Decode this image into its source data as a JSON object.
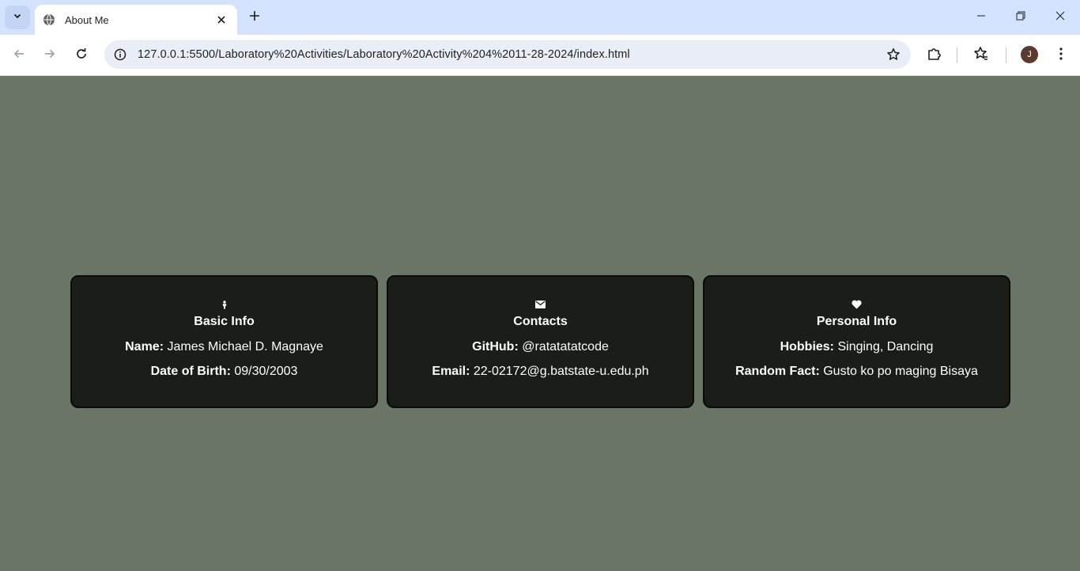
{
  "browser": {
    "tab_title": "About Me",
    "url": "127.0.0.1:5500/Laboratory%20Activities/Laboratory%20Activity%204%2011-28-2024/index.html",
    "profile_initial": "J"
  },
  "colors": {
    "page_background": "#6b7565",
    "card_background": "#1b1d18",
    "tabstrip": "#d3e3fd"
  },
  "cards": [
    {
      "icon": "person-icon",
      "title": "Basic Info",
      "rows": [
        {
          "label": "Name:",
          "value": "James Michael D. Magnaye"
        },
        {
          "label": "Date of Birth:",
          "value": "09/30/2003"
        }
      ]
    },
    {
      "icon": "envelope-icon",
      "title": "Contacts",
      "rows": [
        {
          "label": "GitHub:",
          "value": "@ratatatatcode"
        },
        {
          "label": "Email:",
          "value": "22-02172@g.batstate-u.edu.ph"
        }
      ]
    },
    {
      "icon": "heart-icon",
      "title": "Personal Info",
      "rows": [
        {
          "label": "Hobbies:",
          "value": "Singing, Dancing"
        },
        {
          "label": "Random Fact:",
          "value": "Gusto ko po maging Bisaya"
        }
      ]
    }
  ]
}
